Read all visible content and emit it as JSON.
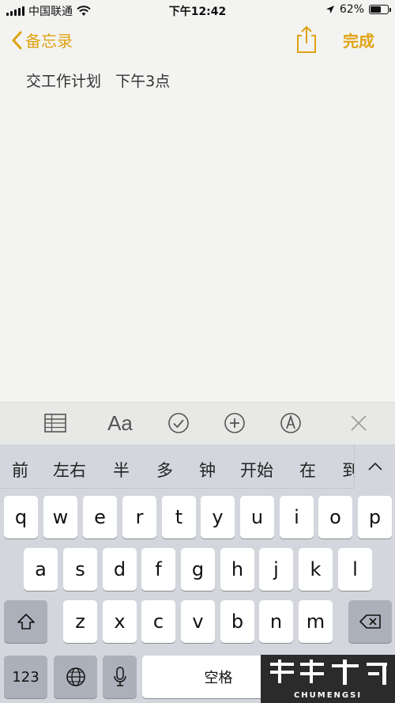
{
  "status_bar": {
    "carrier": "中国联通",
    "time": "下午12:42",
    "battery_percent": "62%",
    "battery_level": 0.62
  },
  "nav": {
    "back_label": "备忘录",
    "done_label": "完成"
  },
  "note": {
    "text": "交工作计划   下午3点"
  },
  "toolbar": {
    "font_label": "Aa"
  },
  "candidates": [
    "前",
    "左右",
    "半",
    "多",
    "钟",
    "开始",
    "在",
    "到"
  ],
  "keyboard": {
    "row1": [
      "q",
      "w",
      "e",
      "r",
      "t",
      "y",
      "u",
      "i",
      "o",
      "p"
    ],
    "row2": [
      "a",
      "s",
      "d",
      "f",
      "g",
      "h",
      "j",
      "k",
      "l"
    ],
    "row3": [
      "z",
      "x",
      "c",
      "v",
      "b",
      "n",
      "m"
    ],
    "numbers_label": "123",
    "space_label": "空格"
  },
  "colors": {
    "accent": "#e0a315",
    "keyboard_bg": "#d3d6dc",
    "key_bg": "#ffffff",
    "dark_key_bg": "#abb0ba"
  },
  "watermark": {
    "text": "CHUMENGSI"
  }
}
